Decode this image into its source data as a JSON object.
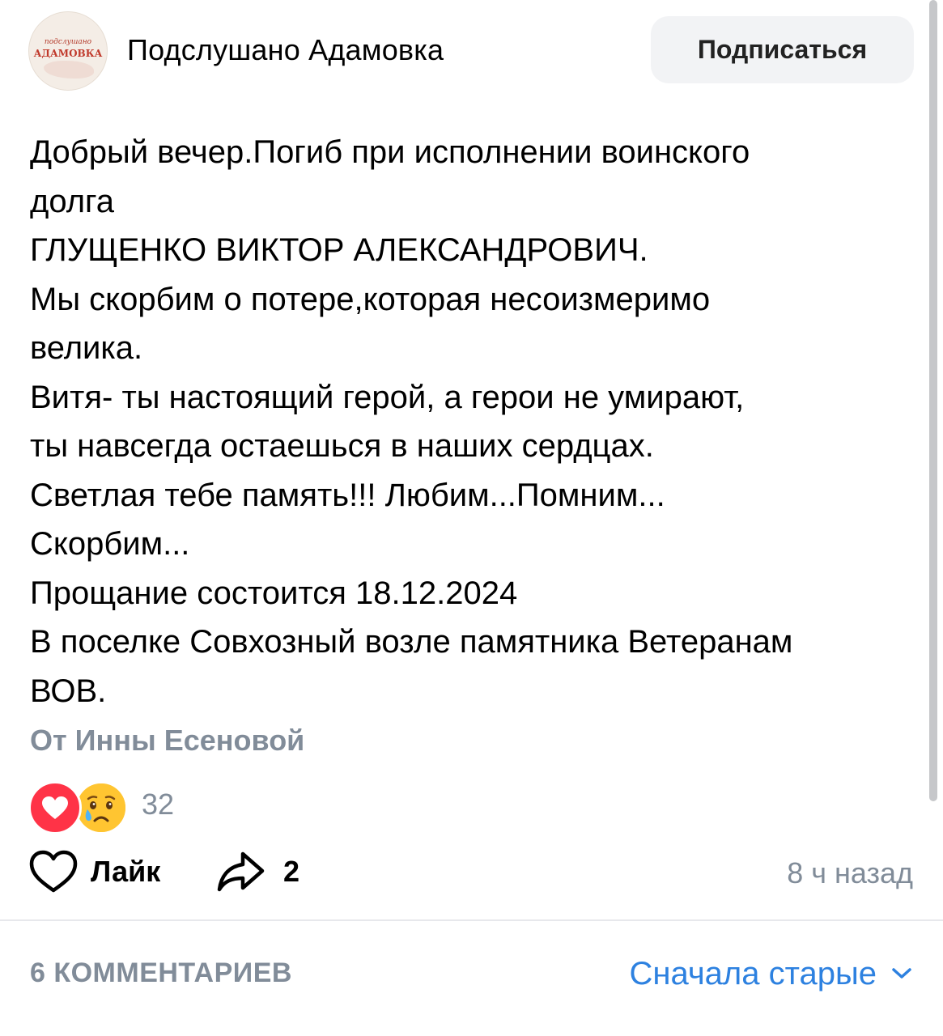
{
  "header": {
    "avatar_small_text": "подслушано",
    "avatar_big_text": "АДАМОВКА",
    "group_name": "Подслушано Адамовка",
    "subscribe_label": "Подписаться"
  },
  "post": {
    "lines": [
      "Добрый вечер.Погиб при исполнении воинского",
      "долга",
      "ГЛУЩЕНКО ВИКТОР АЛЕКСАНДРОВИЧ.",
      "Мы скорбим о потере,которая несоизмеримо",
      "велика.",
      "Витя- ты настоящий герой, а герои не умирают,",
      "ты навсегда остаешься в наших сердцах.",
      "Светлая тебе память!!! Любим...Помним...",
      "Скорбим...",
      "Прощание состоится 18.12.2024",
      "В поселке Совхозный возле памятника Ветеранам",
      "ВОВ."
    ],
    "author": "От Инны Есеновой"
  },
  "reactions": {
    "items": [
      {
        "icon": "heart-reaction-icon",
        "color": "#ff3347"
      },
      {
        "icon": "crying-face-reaction-icon",
        "color": "#ffc531"
      }
    ],
    "count": "32"
  },
  "actions": {
    "like_label": "Лайк",
    "share_count": "2",
    "timestamp": "8 ч назад"
  },
  "comments": {
    "count_label": "6 КОММЕНТАРИЕВ",
    "sort_label": "Сначала старые"
  },
  "colors": {
    "accent": "#2d81e0",
    "secondary_text": "#818c99",
    "heart": "#ff3347",
    "button_bg": "#f2f3f5"
  }
}
